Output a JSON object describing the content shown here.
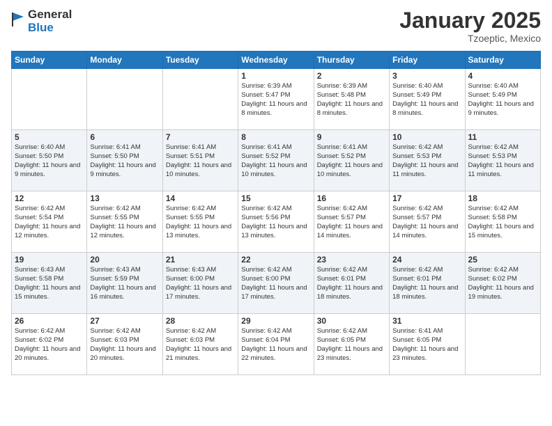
{
  "logo": {
    "general": "General",
    "blue": "Blue"
  },
  "title": "January 2025",
  "location": "Tzoeptic, Mexico",
  "days_header": [
    "Sunday",
    "Monday",
    "Tuesday",
    "Wednesday",
    "Thursday",
    "Friday",
    "Saturday"
  ],
  "weeks": [
    [
      {
        "day": "",
        "info": ""
      },
      {
        "day": "",
        "info": ""
      },
      {
        "day": "",
        "info": ""
      },
      {
        "day": "1",
        "info": "Sunrise: 6:39 AM\nSunset: 5:47 PM\nDaylight: 11 hours and 8 minutes."
      },
      {
        "day": "2",
        "info": "Sunrise: 6:39 AM\nSunset: 5:48 PM\nDaylight: 11 hours and 8 minutes."
      },
      {
        "day": "3",
        "info": "Sunrise: 6:40 AM\nSunset: 5:49 PM\nDaylight: 11 hours and 8 minutes."
      },
      {
        "day": "4",
        "info": "Sunrise: 6:40 AM\nSunset: 5:49 PM\nDaylight: 11 hours and 9 minutes."
      }
    ],
    [
      {
        "day": "5",
        "info": "Sunrise: 6:40 AM\nSunset: 5:50 PM\nDaylight: 11 hours and 9 minutes."
      },
      {
        "day": "6",
        "info": "Sunrise: 6:41 AM\nSunset: 5:50 PM\nDaylight: 11 hours and 9 minutes."
      },
      {
        "day": "7",
        "info": "Sunrise: 6:41 AM\nSunset: 5:51 PM\nDaylight: 11 hours and 10 minutes."
      },
      {
        "day": "8",
        "info": "Sunrise: 6:41 AM\nSunset: 5:52 PM\nDaylight: 11 hours and 10 minutes."
      },
      {
        "day": "9",
        "info": "Sunrise: 6:41 AM\nSunset: 5:52 PM\nDaylight: 11 hours and 10 minutes."
      },
      {
        "day": "10",
        "info": "Sunrise: 6:42 AM\nSunset: 5:53 PM\nDaylight: 11 hours and 11 minutes."
      },
      {
        "day": "11",
        "info": "Sunrise: 6:42 AM\nSunset: 5:53 PM\nDaylight: 11 hours and 11 minutes."
      }
    ],
    [
      {
        "day": "12",
        "info": "Sunrise: 6:42 AM\nSunset: 5:54 PM\nDaylight: 11 hours and 12 minutes."
      },
      {
        "day": "13",
        "info": "Sunrise: 6:42 AM\nSunset: 5:55 PM\nDaylight: 11 hours and 12 minutes."
      },
      {
        "day": "14",
        "info": "Sunrise: 6:42 AM\nSunset: 5:55 PM\nDaylight: 11 hours and 13 minutes."
      },
      {
        "day": "15",
        "info": "Sunrise: 6:42 AM\nSunset: 5:56 PM\nDaylight: 11 hours and 13 minutes."
      },
      {
        "day": "16",
        "info": "Sunrise: 6:42 AM\nSunset: 5:57 PM\nDaylight: 11 hours and 14 minutes."
      },
      {
        "day": "17",
        "info": "Sunrise: 6:42 AM\nSunset: 5:57 PM\nDaylight: 11 hours and 14 minutes."
      },
      {
        "day": "18",
        "info": "Sunrise: 6:42 AM\nSunset: 5:58 PM\nDaylight: 11 hours and 15 minutes."
      }
    ],
    [
      {
        "day": "19",
        "info": "Sunrise: 6:43 AM\nSunset: 5:58 PM\nDaylight: 11 hours and 15 minutes."
      },
      {
        "day": "20",
        "info": "Sunrise: 6:43 AM\nSunset: 5:59 PM\nDaylight: 11 hours and 16 minutes."
      },
      {
        "day": "21",
        "info": "Sunrise: 6:43 AM\nSunset: 6:00 PM\nDaylight: 11 hours and 17 minutes."
      },
      {
        "day": "22",
        "info": "Sunrise: 6:42 AM\nSunset: 6:00 PM\nDaylight: 11 hours and 17 minutes."
      },
      {
        "day": "23",
        "info": "Sunrise: 6:42 AM\nSunset: 6:01 PM\nDaylight: 11 hours and 18 minutes."
      },
      {
        "day": "24",
        "info": "Sunrise: 6:42 AM\nSunset: 6:01 PM\nDaylight: 11 hours and 18 minutes."
      },
      {
        "day": "25",
        "info": "Sunrise: 6:42 AM\nSunset: 6:02 PM\nDaylight: 11 hours and 19 minutes."
      }
    ],
    [
      {
        "day": "26",
        "info": "Sunrise: 6:42 AM\nSunset: 6:02 PM\nDaylight: 11 hours and 20 minutes."
      },
      {
        "day": "27",
        "info": "Sunrise: 6:42 AM\nSunset: 6:03 PM\nDaylight: 11 hours and 20 minutes."
      },
      {
        "day": "28",
        "info": "Sunrise: 6:42 AM\nSunset: 6:03 PM\nDaylight: 11 hours and 21 minutes."
      },
      {
        "day": "29",
        "info": "Sunrise: 6:42 AM\nSunset: 6:04 PM\nDaylight: 11 hours and 22 minutes."
      },
      {
        "day": "30",
        "info": "Sunrise: 6:42 AM\nSunset: 6:05 PM\nDaylight: 11 hours and 23 minutes."
      },
      {
        "day": "31",
        "info": "Sunrise: 6:41 AM\nSunset: 6:05 PM\nDaylight: 11 hours and 23 minutes."
      },
      {
        "day": "",
        "info": ""
      }
    ]
  ]
}
